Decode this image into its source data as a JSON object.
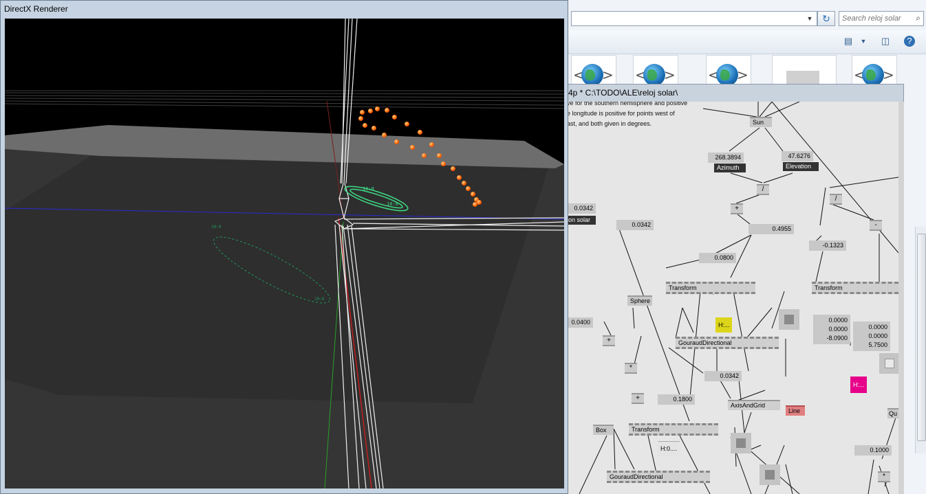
{
  "explorer": {
    "search_placeholder": "Search reloj solar",
    "refresh_icon": "refresh-icon",
    "file_icons": [
      "html-file-icon",
      "html-file-icon",
      "html-file-icon",
      "blank-file-icon",
      "html-file-icon"
    ]
  },
  "patch": {
    "title": "4p *  C:\\TODO\\ALE\\reloj solar\\",
    "description": [
      "ve for the southern hemisphere and positive",
      "e longitude is positive for points west of",
      "ast, and both given in degrees."
    ],
    "nodes": {
      "sun": "Sun",
      "azimuth_value": "268.3894",
      "azimuth_label": "Azimuth",
      "elevation_value": "47.6276",
      "elevation_label": "Elevation",
      "val_0342_a": "0.0342",
      "on_solar": "on solar",
      "val_0342_b": "0.0342",
      "val_04955": "0.4955",
      "val_neg01323": "-0.1323",
      "val_00800": "0.0800",
      "transform_1": "Transform",
      "transform_2": "Transform",
      "sphere": "Sphere",
      "h_yellow": "H:...",
      "gouraud_1": "GouraudDirectional",
      "val_0400": "0.0400",
      "vec_a": "0.0000\n0.0000\n-8.0900",
      "vec_b": "0.0000\n0.0000\n5.7500",
      "h_magenta": "H:...",
      "val_0342_c": "0.0342",
      "val_01800": "0.1800",
      "axis_and_grid": "AxisAndGrid",
      "line": "Line",
      "box": "Box",
      "transform_3": "Transform",
      "h_gray": "H:0....",
      "gouraud_2": "GouraudDirectional",
      "val_01000": "0.1000",
      "qu": "Qu"
    },
    "ops": {
      "div": "/",
      "plus_a": "+",
      "div_b": "/",
      "minus": "-",
      "plus_b": "+",
      "mul_a": "*",
      "plus_c": "+",
      "mul_b": "*"
    }
  },
  "renderer": {
    "title": "DirectX Renderer",
    "label_text": "10:0",
    "colors": {
      "sun_points": "#ff5a00",
      "hour_labels": "#3ddc84",
      "shadow_labels": "#1f9a5a"
    }
  }
}
